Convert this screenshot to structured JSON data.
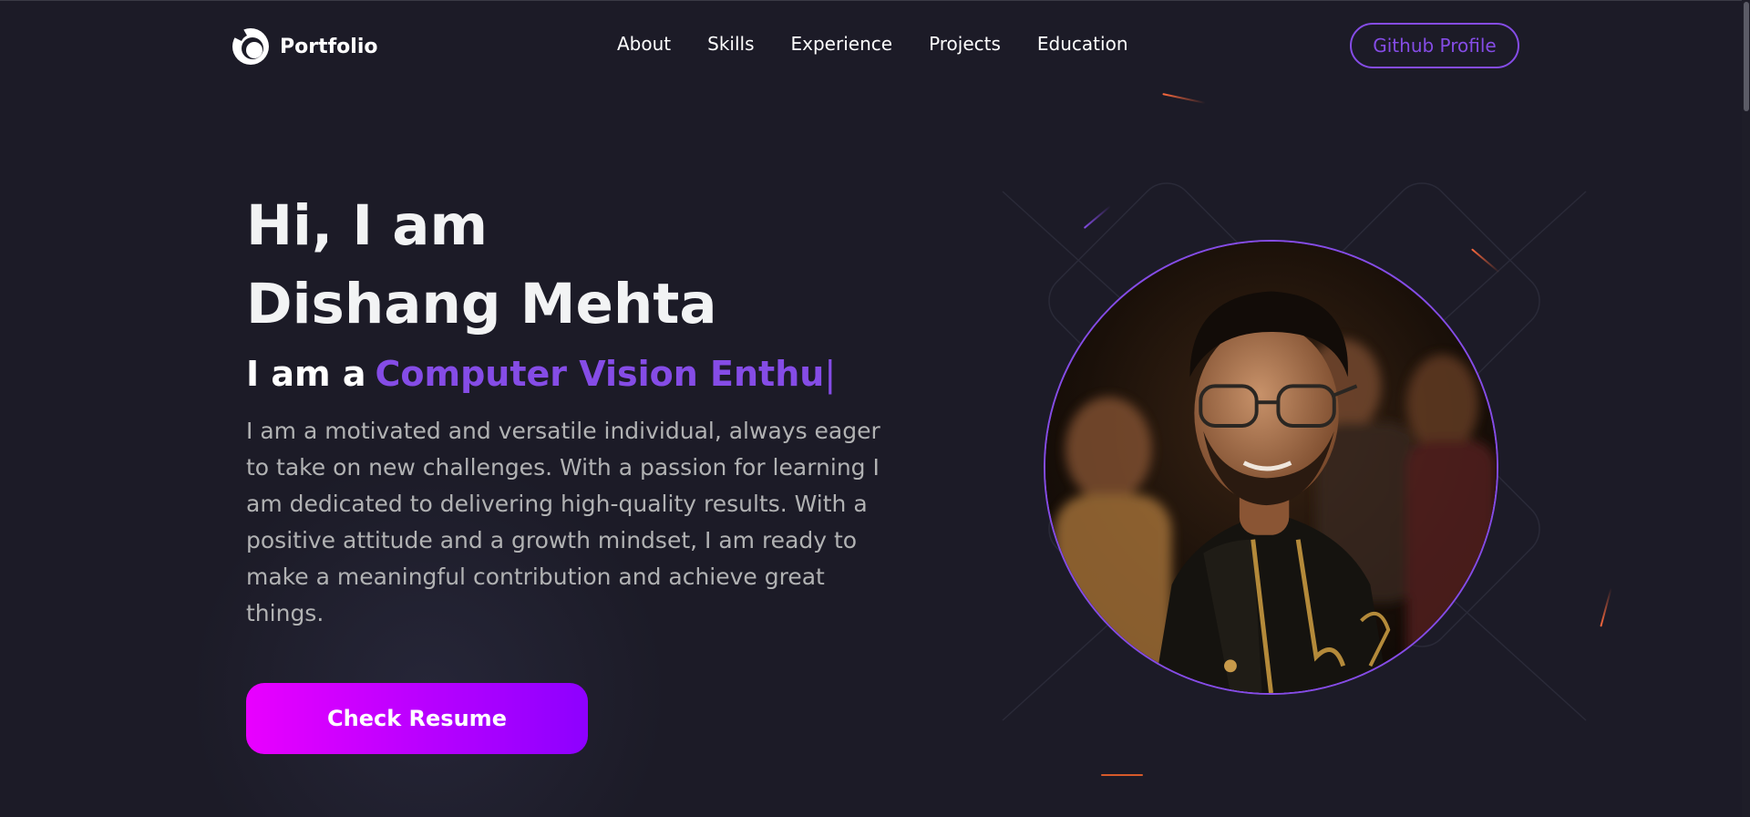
{
  "navbar": {
    "brand_name": "Portfolio",
    "links": [
      "About",
      "Skills",
      "Experience",
      "Projects",
      "Education"
    ],
    "github_button": "Github Profile"
  },
  "hero": {
    "greeting": "Hi, I am",
    "name": "Dishang Mehta",
    "role_prefix": "I am a",
    "role_typed": "Computer Vision Enthu",
    "cursor": "|",
    "description": "I am a motivated and versatile individual, always eager to take on new challenges. With a passion for learning I am dedicated to delivering high-quality results. With a positive attitude and a growth mindset, I am ready to make a meaningful contribution and achieve great things.",
    "resume_button": "Check Resume"
  },
  "colors": {
    "background": "#1c1b27",
    "accent": "#854ce6",
    "text_primary": "#f2f3f4",
    "text_secondary": "#b1b2b3",
    "button_gradient_start": "#e900ff",
    "button_gradient_end": "#8d00ff"
  },
  "icons": {
    "brand_logo": "portfolio-logo-icon"
  }
}
